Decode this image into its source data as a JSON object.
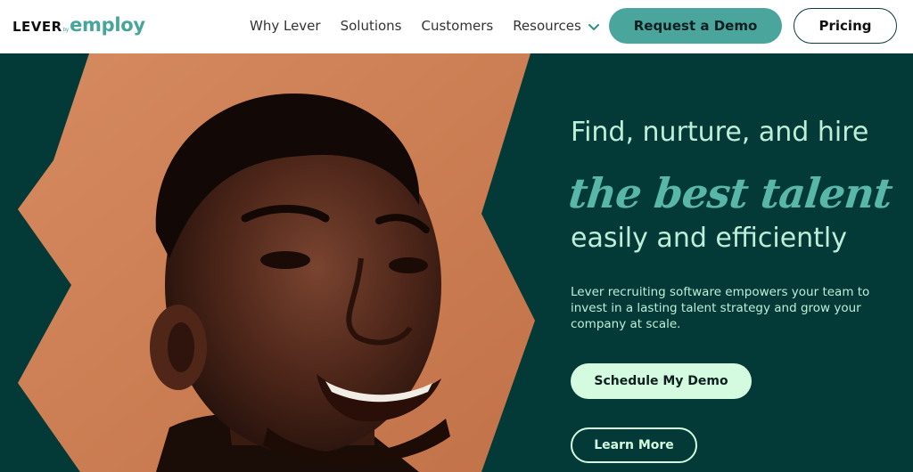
{
  "header": {
    "logo": {
      "brand": "LEVER",
      "by": "by",
      "employ": "employ"
    },
    "nav": [
      {
        "label": "Why Lever"
      },
      {
        "label": "Solutions"
      },
      {
        "label": "Customers"
      },
      {
        "label": "Resources",
        "icon": "chevron-down-icon"
      }
    ],
    "cta_demo": "Request a Demo",
    "cta_pricing": "Pricing"
  },
  "hero": {
    "headline_line1": "Find, nurture, and hire",
    "headline_script": "the best talent",
    "headline_line3": "easily and efficiently",
    "body": "Lever recruiting software empowers your team to invest in a lasting talent strategy and grow your company at scale.",
    "primary_button": "Schedule My Demo",
    "secondary_button": "Learn More",
    "image": "smiling-man-portrait"
  },
  "colors": {
    "hero_bg": "#033a37",
    "accent_teal": "#4aa59d",
    "mint": "#d4fbdf",
    "headline_mint": "#bdeed8",
    "script_teal": "#58b7a8",
    "shape_orange": "#cd7f55"
  }
}
